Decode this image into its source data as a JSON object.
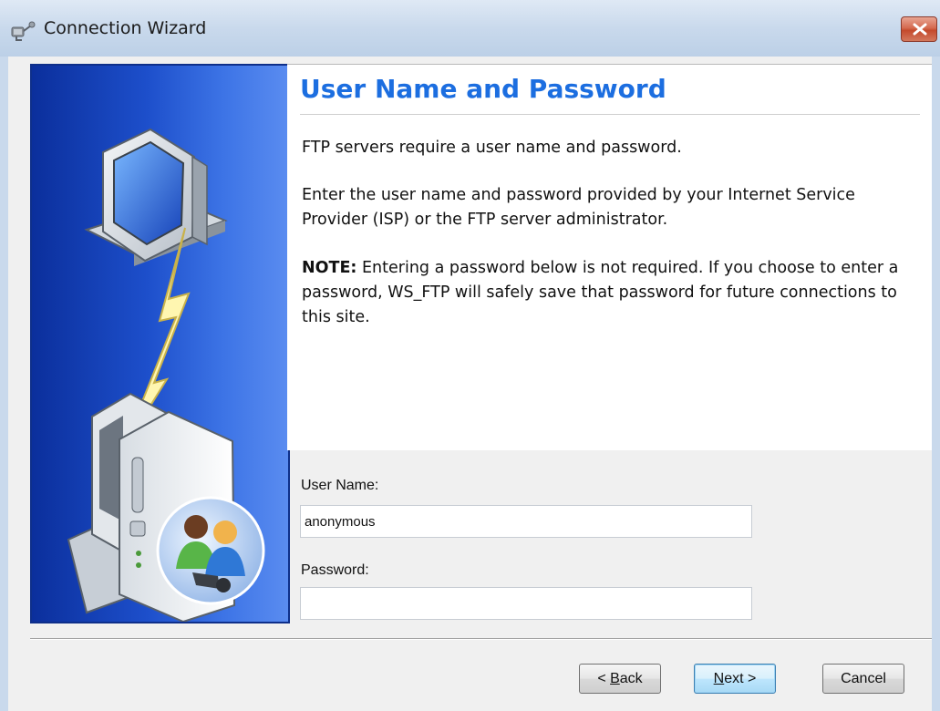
{
  "window": {
    "title": "Connection Wizard",
    "close_symbol": "x",
    "icon": "connection-wizard-icon"
  },
  "content": {
    "heading": "User Name and Password",
    "paragraph1": "FTP servers require a user name and password.",
    "paragraph2": "Enter the user name and password provided by your Internet Service Provider (ISP) or the FTP server administrator.",
    "note_label": "NOTE:",
    "note_text": " Entering a password below is not required. If you choose to enter a password, WS_FTP will safely save that password for future connections to this site."
  },
  "form": {
    "user_name_label": "User Name:",
    "user_name_value": "anonymous",
    "password_label": "Password:",
    "password_value": ""
  },
  "buttons": {
    "back_prefix": "< ",
    "back_accel": "B",
    "back_rest": "ack",
    "next_accel": "N",
    "next_rest": "ext >",
    "cancel": "Cancel"
  },
  "colors": {
    "heading": "#1c6ee0",
    "panel_blue": "#1d4fcb",
    "close_red": "#c44a2c"
  }
}
